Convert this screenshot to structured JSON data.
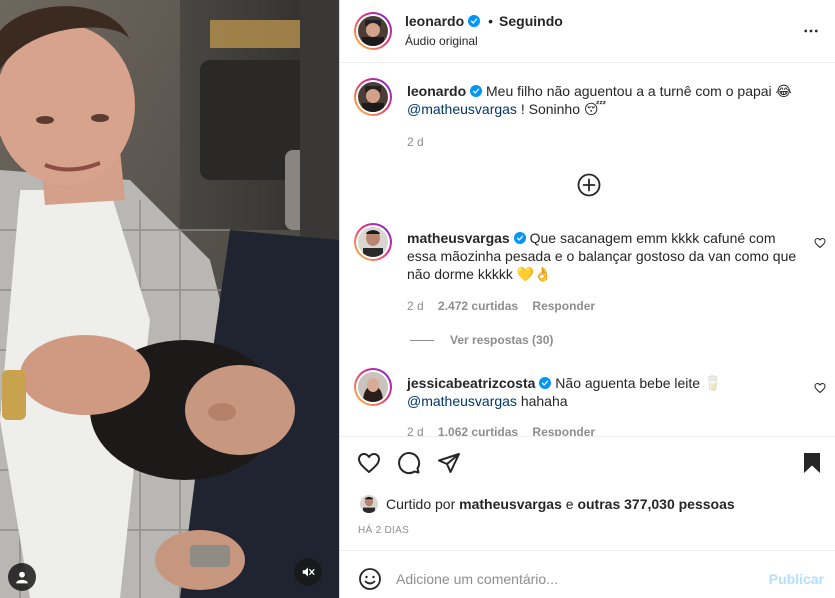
{
  "post": {
    "author": "leonardo",
    "follow_state": "Seguindo",
    "audio": "Áudio original"
  },
  "caption": {
    "username": "leonardo",
    "text": "Meu filho não aguentou a a turnê com o papai 😂",
    "mention": "@matheusvargas",
    "text_after": "! Soninho 😴",
    "time": "2 d"
  },
  "comments": [
    {
      "username": "matheusvargas",
      "text": "Que sacanagem emm kkkk cafuné com essa mãozinha pesada e o balançar gostoso da van como que não dorme kkkkk 💛👌",
      "time": "2 d",
      "likes": "2.472 curtidas",
      "reply": "Responder",
      "view_replies": "Ver respostas (30)"
    },
    {
      "username": "jessicabeatrizcosta",
      "text": "Não aguenta bebe leite 🥛",
      "mention": "@matheusvargas",
      "text_after": "hahaha",
      "time": "2 d",
      "likes": "1.062 curtidas",
      "reply": "Responder"
    }
  ],
  "likes": {
    "prefix": "Curtido por",
    "user": "matheusvargas",
    "connector": "e",
    "others": "outras 377,030 pessoas"
  },
  "date": "HÁ 2 DIAS",
  "comment_box": {
    "placeholder": "Adicione um comentário...",
    "publish": "Publicar"
  },
  "colors": {
    "verified": "#0095f6",
    "mention": "#00376b",
    "publish_disabled": "#b2dffc",
    "secondary_text": "#8e8e8e"
  }
}
